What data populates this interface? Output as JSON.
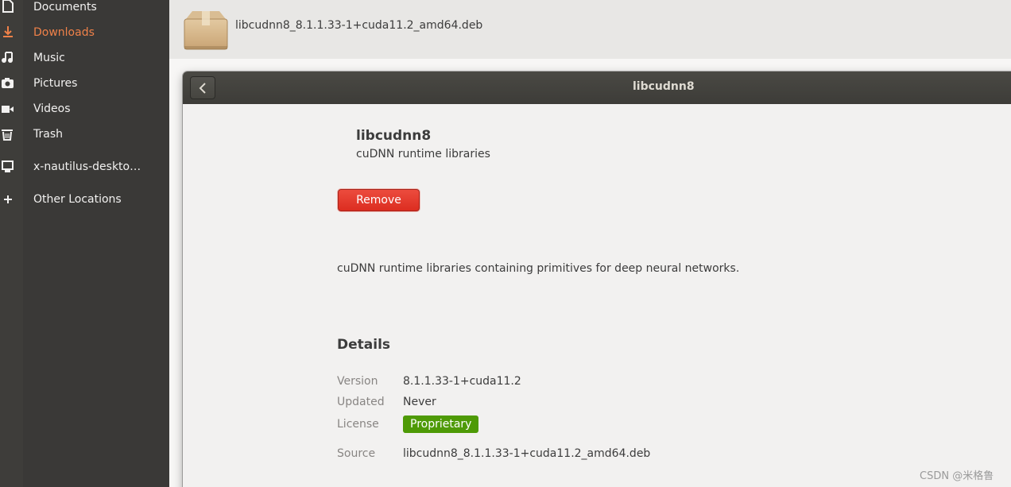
{
  "sidebar": {
    "items": [
      {
        "label": "Documents",
        "icon": "document-icon"
      },
      {
        "label": "Downloads",
        "icon": "download-icon",
        "active": true
      },
      {
        "label": "Music",
        "icon": "music-icon"
      },
      {
        "label": "Pictures",
        "icon": "camera-icon"
      },
      {
        "label": "Videos",
        "icon": "video-icon"
      },
      {
        "label": "Trash",
        "icon": "trash-icon"
      },
      {
        "label": "x-nautilus-deskto…",
        "icon": "network-drive-icon"
      },
      {
        "label": "Other Locations",
        "icon": "plus-icon"
      }
    ]
  },
  "file": {
    "name": "libcudnn8_8.1.1.33-1+cuda11.2_amd64.deb",
    "icon": "package-icon"
  },
  "dialog": {
    "title": "libcudnn8",
    "back_icon": "chevron-left-icon",
    "app_name": "libcudnn8",
    "summary": "cuDNN runtime libraries",
    "remove_label": "Remove",
    "description": "cuDNN runtime libraries containing primitives for deep neural networks.",
    "details_heading": "Details",
    "details": {
      "version_label": "Version",
      "version_value": "8.1.1.33-1+cuda11.2",
      "updated_label": "Updated",
      "updated_value": "Never",
      "license_label": "License",
      "license_value": "Proprietary",
      "source_label": "Source",
      "source_value": "libcudnn8_8.1.1.33-1+cuda11.2_amd64.deb"
    }
  },
  "watermark": "CSDN @米格鲁",
  "colors": {
    "accent_active": "#ef8149",
    "remove_red": "#dc2d20",
    "license_green": "#4e9a06",
    "sidebar_bg": "#3a3937",
    "titlebar_bg": "#3d3c38"
  }
}
